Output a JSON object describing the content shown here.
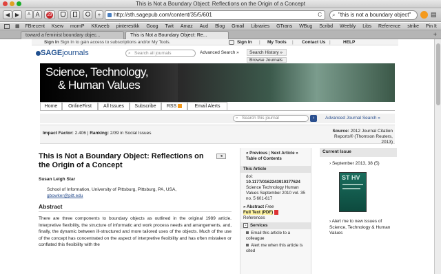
{
  "window": {
    "title": "This is Not a Boundary Object: Reflections on the Origin of a Concept"
  },
  "toolbar": {
    "back": "◀",
    "forward": "▶",
    "text_small": "A",
    "text_large": "A",
    "badge": "29",
    "add": "+",
    "url": "http://sth.sagepub.com/content/35/5/601",
    "reload": "C",
    "search": "\"this is not a boundary object\""
  },
  "bookmarks": [
    "FBrecent",
    "Ksew",
    "mornP",
    "KKweeb",
    "pinterestkk",
    "Goog",
    "Twit",
    "Amaz",
    "Aud",
    "Blog",
    "Gmail",
    "Libraries",
    "GTrans",
    "WBug",
    "Scribd",
    "Weebly",
    "Libs",
    "Reference",
    "strike",
    "Pin It"
  ],
  "tabs": [
    "toward a feminist boundary objec...",
    "This is Not a Boundary Object: Re..."
  ],
  "site": {
    "signin_text": "Sign In to gain access to subscriptions and/or My Tools.",
    "signin": "Sign In",
    "mytools": "My Tools",
    "contact": "Contact Us",
    "help": "HELP",
    "logo_sage": "SAGE",
    "logo_journals": "journals",
    "search_placeholder": "Search all journals",
    "advanced_search": "Advanced Search »",
    "search_history": "Search History »",
    "browse_journals": "Browse Journals »",
    "banner_line1": "Science, Technology,",
    "banner_line2": "& Human Values",
    "nav": [
      "Home",
      "OnlineFirst",
      "All Issues",
      "Subscribe",
      "RSS",
      "Email Alerts"
    ],
    "search_journal_placeholder": "Search this journal",
    "adv_journal_search": "Advanced Journal Search »",
    "impact": "Impact Factor:",
    "impact_val": "2.406",
    "ranking": "Ranking:",
    "ranking_val": "2/39 in Social Issues",
    "source": "Source:",
    "source_val": "2012 Journal Citation Reports® (Thomson Reuters, 2013)"
  },
  "article": {
    "title": "This is Not a Boundary Object: Reflections on the Origin of a Concept",
    "author": "Susan Leigh Star",
    "affil": "School of Information, University of Pittsburg, Pittsburg, PA, USA,",
    "email": "gbowker@pitt.edu",
    "abstract_heading": "Abstract",
    "abstract": "There are three components to boundary objects as outlined in the original 1989 article. Interpretive flexibility, the structure of informatic and work process needs and arrangements, and, finally, the dynamic between ill-structured and more tailored uses of the objects. Much of the use of the concept has concentrated on the aspect of interpretive flexibility and has often mistaken or conflated this flexibility with the",
    "collapse": "◂"
  },
  "mid": {
    "prev": "« Previous",
    "next": "Next Article »",
    "toc": "Table of Contents",
    "this_article": "This Article",
    "doi_label": "doi:",
    "doi": "10.1177/0162243910377624",
    "citation": "Science Technology Human Values September 2010 vol. 35 no. 5 601-617",
    "abstract_free": "» Abstract",
    "free": "Free",
    "fulltext": "Full Text (PDF)",
    "references": "References",
    "services": "Services",
    "svc1": "Email this article to a colleague",
    "svc2": "Alert me when this article is cited"
  },
  "right": {
    "current_issue": "Current Issue",
    "issue": "September 2013, 38 (5)",
    "cover_title": "ST HV",
    "alert": "Alert me to new issues of Science, Technology & Human Values"
  }
}
